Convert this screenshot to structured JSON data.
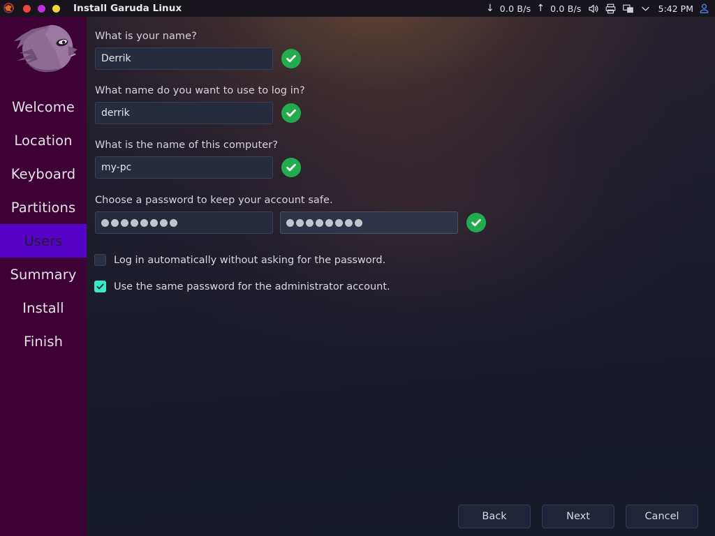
{
  "titlebar": {
    "app_icon": "garuda-icon",
    "title": "Install Garuda Linux",
    "window_buttons": [
      {
        "name": "close-button",
        "color": "#f0463f"
      },
      {
        "name": "maximize-button",
        "color": "#c22ee0"
      },
      {
        "name": "minimize-button",
        "color": "#efd43a"
      }
    ],
    "tray": {
      "download_arrow": "↓",
      "download_speed": "0.0 B/s",
      "upload_arrow": "↑",
      "upload_speed": "0.0 B/s",
      "volume_icon": "volume-icon",
      "printer_icon": "printer-icon",
      "display_icon": "display-icon",
      "chevron_icon": "chevron-down-icon",
      "time": "5:42 PM",
      "user_icon": "user-icon"
    }
  },
  "sidebar": {
    "logo": "garuda-eagle-logo",
    "active_index": 4,
    "items": [
      {
        "label": "Welcome"
      },
      {
        "label": "Location"
      },
      {
        "label": "Keyboard"
      },
      {
        "label": "Partitions"
      },
      {
        "label": "Users"
      },
      {
        "label": "Summary"
      },
      {
        "label": "Install"
      },
      {
        "label": "Finish"
      }
    ]
  },
  "main": {
    "fields": [
      {
        "label": "What is your name?",
        "value": "Derrik",
        "placeholder": "",
        "valid": true,
        "name": "full-name"
      },
      {
        "label": "What name do you want to use to log in?",
        "value": "derrik",
        "placeholder": "",
        "valid": true,
        "name": "login-name"
      },
      {
        "label": "What is the name of this computer?",
        "value": "my-pc",
        "placeholder": "",
        "valid": true,
        "name": "hostname"
      }
    ],
    "password": {
      "label": "Choose a password to keep your account safe.",
      "field_chars": 8,
      "confirm_chars": 8,
      "valid": true
    },
    "checkboxes": [
      {
        "label": "Log in automatically without asking for the password.",
        "checked": false,
        "name": "autologin-checkbox"
      },
      {
        "label": "Use the same password for the administrator account.",
        "checked": true,
        "name": "same-admin-password-checkbox"
      }
    ]
  },
  "footer": {
    "back_label": "Back",
    "next_label": "Next",
    "cancel_label": "Cancel"
  },
  "colors": {
    "sidebar_bg": "#3e0136",
    "sidebar_active": "#5503c6",
    "valid_green": "#23ac4e",
    "checkbox_on": "#3ce9c9",
    "page_bg": "#181a29"
  }
}
